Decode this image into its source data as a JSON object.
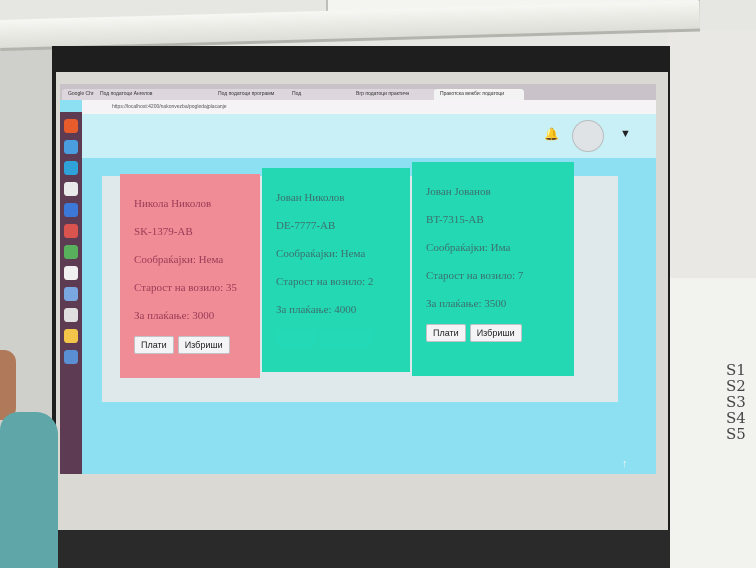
{
  "browser": {
    "tabs": [
      {
        "label": "Google Chrome"
      },
      {
        "label": "Под податоци Ангелов"
      },
      {
        "label": "Под податоци программ"
      },
      {
        "label": "Под"
      },
      {
        "label": "Вгр податоци практичн"
      },
      {
        "label": "Пракотска вежби: податоци"
      }
    ],
    "url": "https://localhost:4200/nakonvezba/pogledajplacanje"
  },
  "header": {
    "bell_icon": "bell-icon",
    "avatar_icon": "user-avatar-icon",
    "menu_icon": "caret-down-icon"
  },
  "cards": [
    {
      "name": "Никола Николов",
      "plate": "SK-1379-AB",
      "violation": "Сообраќајки: Нема",
      "age": "Старост на возило: 35",
      "payment": "За плаќање: 3000",
      "pay_label": "Плати",
      "delete_label": "Избриши",
      "color": "#f08c95"
    },
    {
      "name": "Јован Николов",
      "plate": "DE-7777-AB",
      "violation": "Сообраќајки: Нема",
      "age": "Старост на возило: 2",
      "payment": "За плаќање: 4000",
      "pay_label": "Плати",
      "delete_label": "Избриши",
      "color": "#23d8b3"
    },
    {
      "name": "Јован Јованов",
      "plate": "BT-7315-AB",
      "violation": "Сообраќајки: Има",
      "age": "Старост на возило: 7",
      "payment": "За плаќање: 3500",
      "pay_label": "Плати",
      "delete_label": "Избриши",
      "color": "#23d8b3"
    }
  ],
  "whiteboard": {
    "notes": "S1 S2 S3 S4 S5"
  }
}
